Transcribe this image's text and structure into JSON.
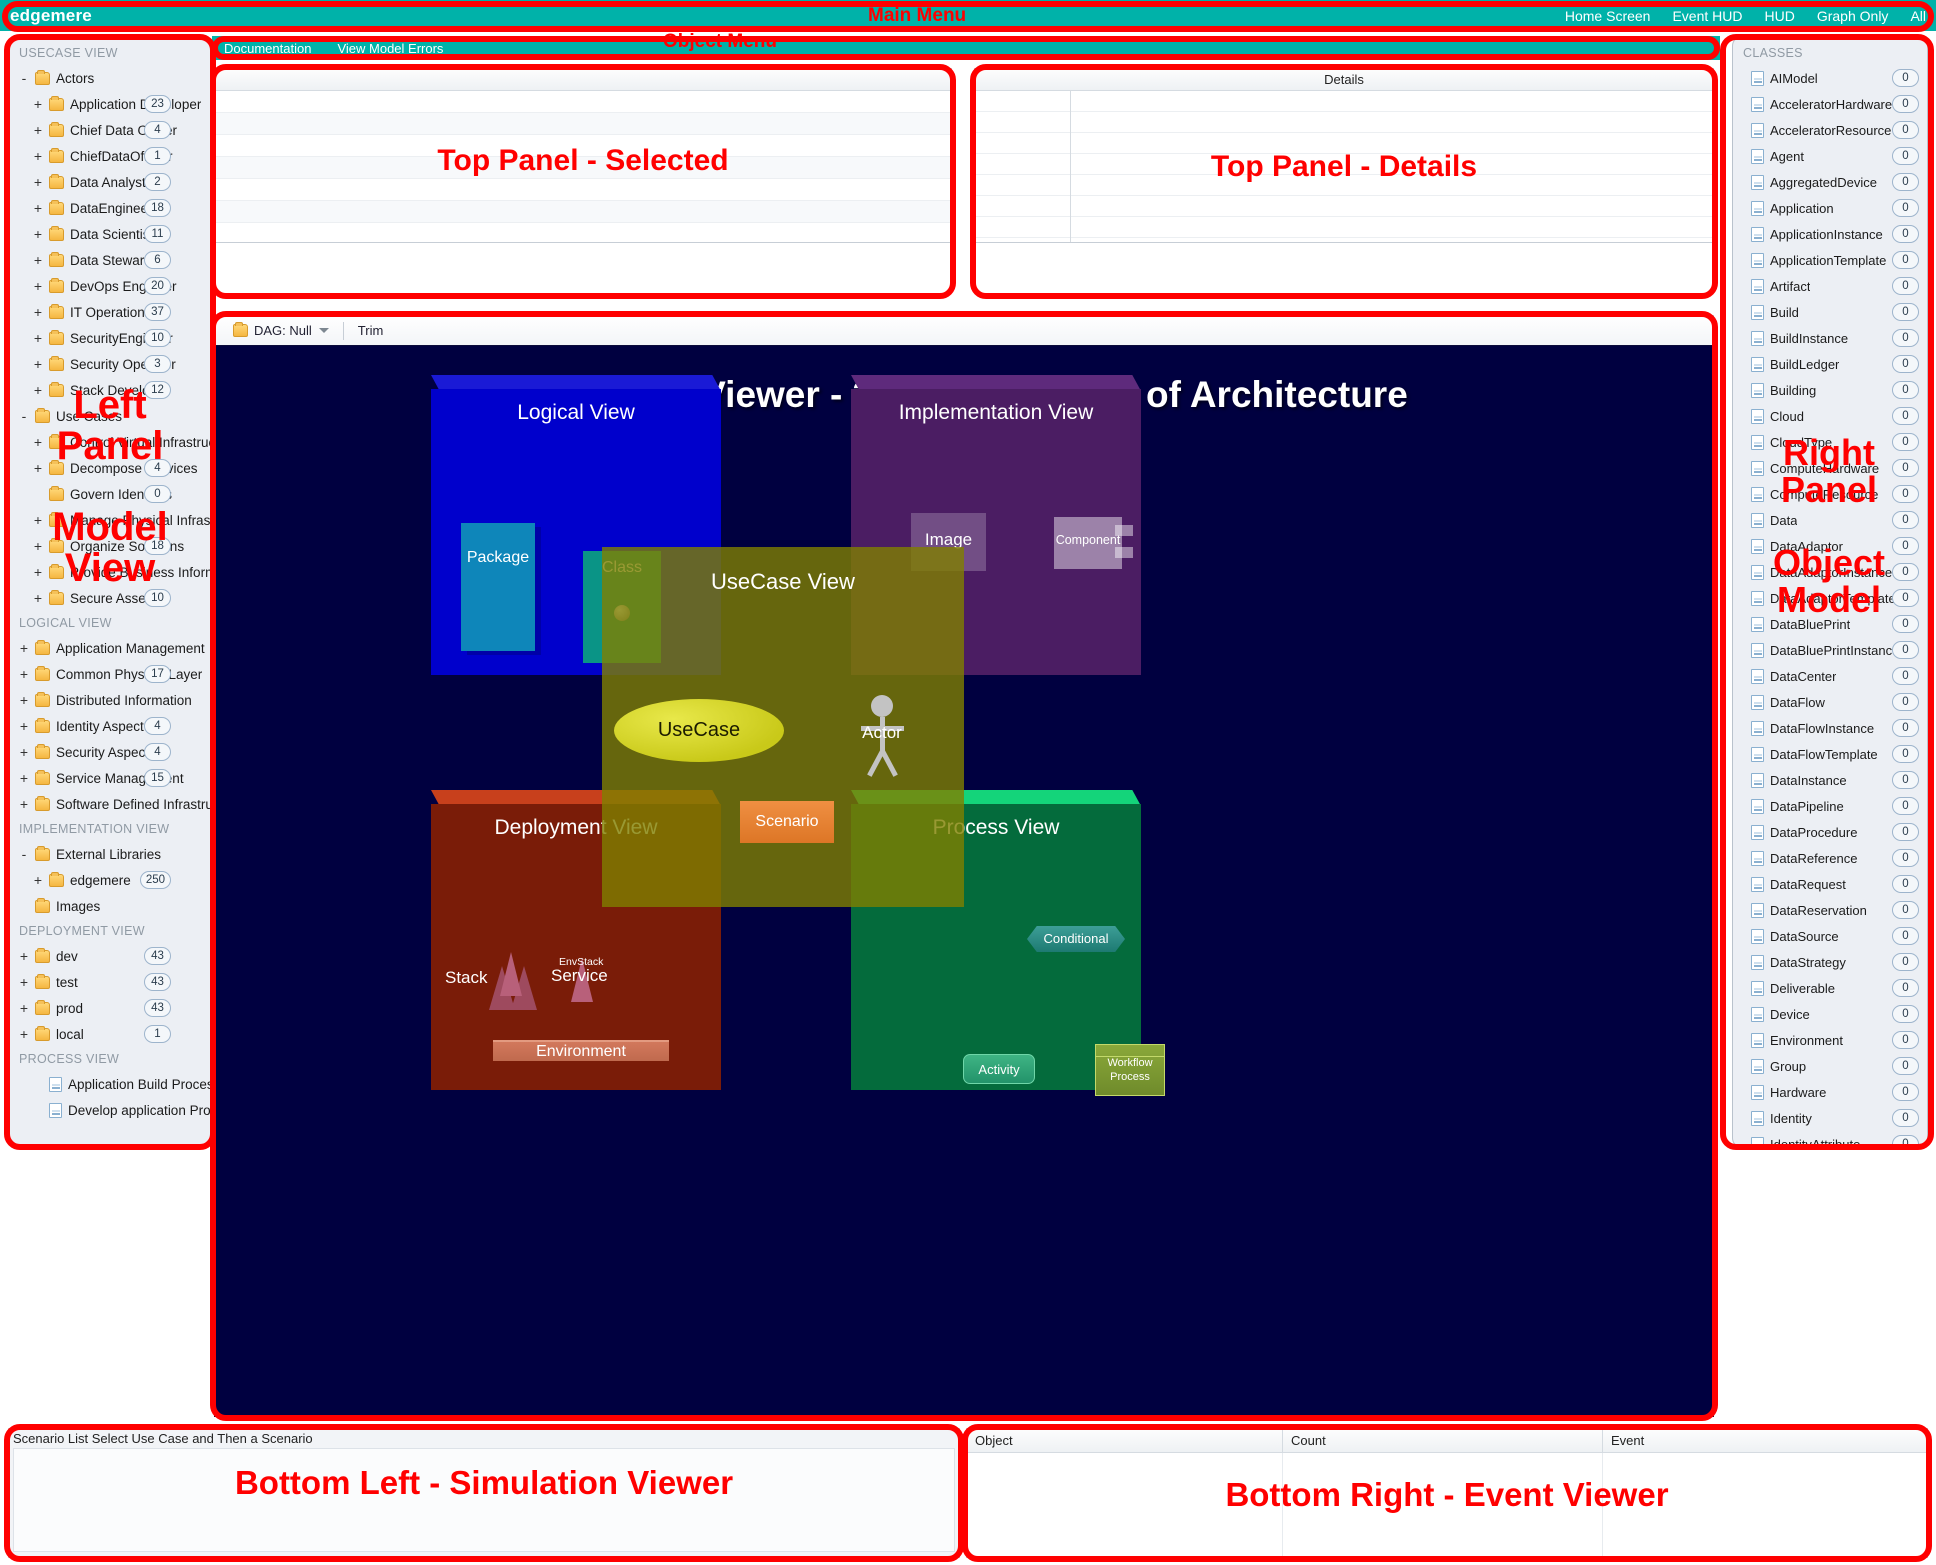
{
  "menubar": {
    "brand": "edgemere",
    "items": [
      "Home Screen",
      "Event HUD",
      "HUD",
      "Graph Only",
      "All"
    ]
  },
  "object_menu": {
    "items": [
      "Documentation",
      "View Model Errors"
    ]
  },
  "annotations": {
    "main_menu": "Main Menu",
    "object_menu": "Object Menu",
    "left_panel": "Left\nPanel\n\nModel\nView",
    "right_panel": "Right\nPanel\n\nObject\nModel",
    "top_panel_selected": "Top Panel - Selected",
    "top_panel_details": "Top Panel - Details",
    "bottom_left": "Bottom Left - Simulation Viewer",
    "bottom_right": "Bottom Right - Event Viewer",
    "color": "#ff0000"
  },
  "top_panels": {
    "details_title": "Details"
  },
  "graph_toolbar": {
    "dag_label": "DAG: Null",
    "trim_label": "Trim"
  },
  "viewer": {
    "title": "Graphical Viewer - 3D Visualization of Architecture",
    "background": "#000040",
    "cubes": [
      {
        "name": "logical",
        "label": "Logical\nView",
        "color": "#0000cc"
      },
      {
        "name": "implementation",
        "label": "Implementation\nView",
        "color": "#4b1d63"
      },
      {
        "name": "deployment",
        "label": "Deployment\nView",
        "color": "#7a1c08"
      },
      {
        "name": "process",
        "label": "Process\nView",
        "color": "#046b3c"
      },
      {
        "name": "usecase",
        "label": "UseCase\nView",
        "color": "#808000"
      }
    ],
    "nodes": {
      "package": "Package",
      "class": "Class",
      "image": "Image",
      "component": "Component",
      "stack": "Stack",
      "envstack": "EnvStack",
      "service": "Service",
      "environment": "Environment",
      "conditional": "Conditional",
      "activity": "Activity",
      "workflow": "Workflow\nProcess",
      "usecase": "UseCase",
      "scenario": "Scenario",
      "actor": "Actor"
    }
  },
  "bottom_left": {
    "caption": "Scenario List Select Use Case and Then a Scenario"
  },
  "bottom_right": {
    "columns": [
      "Object",
      "Count",
      "Event"
    ]
  },
  "left_panel": {
    "sections": [
      {
        "title": "USECASE VIEW",
        "items": [
          {
            "twisty": "-",
            "icon": "folder-icon",
            "label": "Actors",
            "indent": 0,
            "badge": ""
          },
          {
            "twisty": "+",
            "icon": "folder-icon",
            "label": "Application Developer",
            "indent": 1,
            "badge": "23"
          },
          {
            "twisty": "+",
            "icon": "folder-icon",
            "label": "Chief Data Officer",
            "indent": 1,
            "badge": "4"
          },
          {
            "twisty": "+",
            "icon": "folder-icon",
            "label": "ChiefDataOfficier",
            "indent": 1,
            "badge": "1"
          },
          {
            "twisty": "+",
            "icon": "folder-icon",
            "label": "Data Analyst",
            "indent": 1,
            "badge": "2"
          },
          {
            "twisty": "+",
            "icon": "folder-icon",
            "label": "DataEngineer",
            "indent": 1,
            "badge": "18"
          },
          {
            "twisty": "+",
            "icon": "folder-icon",
            "label": "Data Scientist",
            "indent": 1,
            "badge": "11"
          },
          {
            "twisty": "+",
            "icon": "folder-icon",
            "label": "Data Steward",
            "indent": 1,
            "badge": "6"
          },
          {
            "twisty": "+",
            "icon": "folder-icon",
            "label": "DevOps Engineer",
            "indent": 1,
            "badge": "20"
          },
          {
            "twisty": "+",
            "icon": "folder-icon",
            "label": "IT Operations",
            "indent": 1,
            "badge": "37"
          },
          {
            "twisty": "+",
            "icon": "folder-icon",
            "label": "SecurityEngineer",
            "indent": 1,
            "badge": "10"
          },
          {
            "twisty": "+",
            "icon": "folder-icon",
            "label": "Security Operator",
            "indent": 1,
            "badge": "3"
          },
          {
            "twisty": "+",
            "icon": "folder-icon",
            "label": "Stack Developer",
            "indent": 1,
            "badge": "12"
          },
          {
            "twisty": "-",
            "icon": "folder-icon",
            "label": "Use Cases",
            "indent": 0,
            "badge": ""
          },
          {
            "twisty": "+",
            "icon": "folder-icon",
            "label": "Control Virtual Infrastructure",
            "indent": 1,
            "badge": ""
          },
          {
            "twisty": "+",
            "icon": "folder-icon",
            "label": "Decompose Services",
            "indent": 1,
            "badge": "4"
          },
          {
            "twisty": "",
            "icon": "folder-icon",
            "label": "Govern Identities",
            "indent": 1,
            "badge": "0"
          },
          {
            "twisty": "+",
            "icon": "folder-icon",
            "label": "Manage Physical Infrastructure",
            "indent": 1,
            "badge": ""
          },
          {
            "twisty": "+",
            "icon": "folder-icon",
            "label": "Organize Solutions",
            "indent": 1,
            "badge": "18"
          },
          {
            "twisty": "+",
            "icon": "folder-icon",
            "label": "Provide Business Information",
            "indent": 1,
            "badge": ""
          },
          {
            "twisty": "+",
            "icon": "folder-icon",
            "label": "Secure Assets",
            "indent": 1,
            "badge": "10"
          }
        ]
      },
      {
        "title": "LOGICAL VIEW",
        "items": [
          {
            "twisty": "+",
            "icon": "folder-icon",
            "label": "Application Management",
            "indent": 0,
            "badge": ""
          },
          {
            "twisty": "+",
            "icon": "folder-icon",
            "label": "Common Physical Layer",
            "indent": 0,
            "badge": "17"
          },
          {
            "twisty": "+",
            "icon": "folder-icon",
            "label": "Distributed Information",
            "indent": 0,
            "badge": ""
          },
          {
            "twisty": "+",
            "icon": "folder-icon",
            "label": "Identity Aspect",
            "indent": 0,
            "badge": "4"
          },
          {
            "twisty": "+",
            "icon": "folder-icon",
            "label": "Security Aspect",
            "indent": 0,
            "badge": "4"
          },
          {
            "twisty": "+",
            "icon": "folder-icon",
            "label": "Service Management",
            "indent": 0,
            "badge": "15"
          },
          {
            "twisty": "+",
            "icon": "folder-icon",
            "label": "Software Defined Infrastructure",
            "indent": 0,
            "badge": ""
          }
        ]
      },
      {
        "title": "IMPLEMENTATION VIEW",
        "items": [
          {
            "twisty": "-",
            "icon": "folder-icon",
            "label": "External Libraries",
            "indent": 0,
            "badge": ""
          },
          {
            "twisty": "+",
            "icon": "folder-icon",
            "label": "edgemere",
            "indent": 1,
            "badge": "250"
          },
          {
            "twisty": "",
            "icon": "folder-icon",
            "label": "Images",
            "indent": 0,
            "badge": ""
          }
        ]
      },
      {
        "title": "DEPLOYMENT VIEW",
        "items": [
          {
            "twisty": "+",
            "icon": "folder-icon",
            "label": "dev",
            "indent": 0,
            "badge": "43"
          },
          {
            "twisty": "+",
            "icon": "folder-icon",
            "label": "test",
            "indent": 0,
            "badge": "43"
          },
          {
            "twisty": "+",
            "icon": "folder-icon",
            "label": "prod",
            "indent": 0,
            "badge": "43"
          },
          {
            "twisty": "+",
            "icon": "folder-icon",
            "label": "local",
            "indent": 0,
            "badge": "1"
          }
        ]
      },
      {
        "title": "PROCESS VIEW",
        "items": [
          {
            "twisty": "",
            "icon": "document-icon",
            "label": "Application Build Process",
            "indent": 1,
            "badge": ""
          },
          {
            "twisty": "",
            "icon": "document-icon",
            "label": "Develop application Process",
            "indent": 1,
            "badge": ""
          }
        ]
      }
    ]
  },
  "right_panel": {
    "title": "CLASSES",
    "items": [
      {
        "label": "AIModel",
        "count": "0"
      },
      {
        "label": "AcceleratorHardware",
        "count": "0"
      },
      {
        "label": "AcceleratorResource",
        "count": "0"
      },
      {
        "label": "Agent",
        "count": "0"
      },
      {
        "label": "AggregatedDevice",
        "count": "0"
      },
      {
        "label": "Application",
        "count": "0"
      },
      {
        "label": "ApplicationInstance",
        "count": "0"
      },
      {
        "label": "ApplicationTemplate",
        "count": "0"
      },
      {
        "label": "Artifact",
        "count": "0"
      },
      {
        "label": "Build",
        "count": "0"
      },
      {
        "label": "BuildInstance",
        "count": "0"
      },
      {
        "label": "BuildLedger",
        "count": "0"
      },
      {
        "label": "Building",
        "count": "0"
      },
      {
        "label": "Cloud",
        "count": "0"
      },
      {
        "label": "CloudType",
        "count": "0"
      },
      {
        "label": "ComputeHardware",
        "count": "0"
      },
      {
        "label": "ComputeResource",
        "count": "0"
      },
      {
        "label": "Data",
        "count": "0"
      },
      {
        "label": "DataAdaptor",
        "count": "0"
      },
      {
        "label": "DataAdaptorInstance",
        "count": "0"
      },
      {
        "label": "DataAdaptorTemplate",
        "count": "0"
      },
      {
        "label": "DataBluePrint",
        "count": "0"
      },
      {
        "label": "DataBluePrintInstance",
        "count": "0"
      },
      {
        "label": "DataCenter",
        "count": "0"
      },
      {
        "label": "DataFlow",
        "count": "0"
      },
      {
        "label": "DataFlowInstance",
        "count": "0"
      },
      {
        "label": "DataFlowTemplate",
        "count": "0"
      },
      {
        "label": "DataInstance",
        "count": "0"
      },
      {
        "label": "DataPipeline",
        "count": "0"
      },
      {
        "label": "DataProcedure",
        "count": "0"
      },
      {
        "label": "DataReference",
        "count": "0"
      },
      {
        "label": "DataRequest",
        "count": "0"
      },
      {
        "label": "DataReservation",
        "count": "0"
      },
      {
        "label": "DataSource",
        "count": "0"
      },
      {
        "label": "DataStrategy",
        "count": "0"
      },
      {
        "label": "Deliverable",
        "count": "0"
      },
      {
        "label": "Device",
        "count": "0"
      },
      {
        "label": "Environment",
        "count": "0"
      },
      {
        "label": "Group",
        "count": "0"
      },
      {
        "label": "Hardware",
        "count": "0"
      },
      {
        "label": "Identity",
        "count": "0"
      },
      {
        "label": "IdentityAttribute",
        "count": "0"
      }
    ]
  }
}
